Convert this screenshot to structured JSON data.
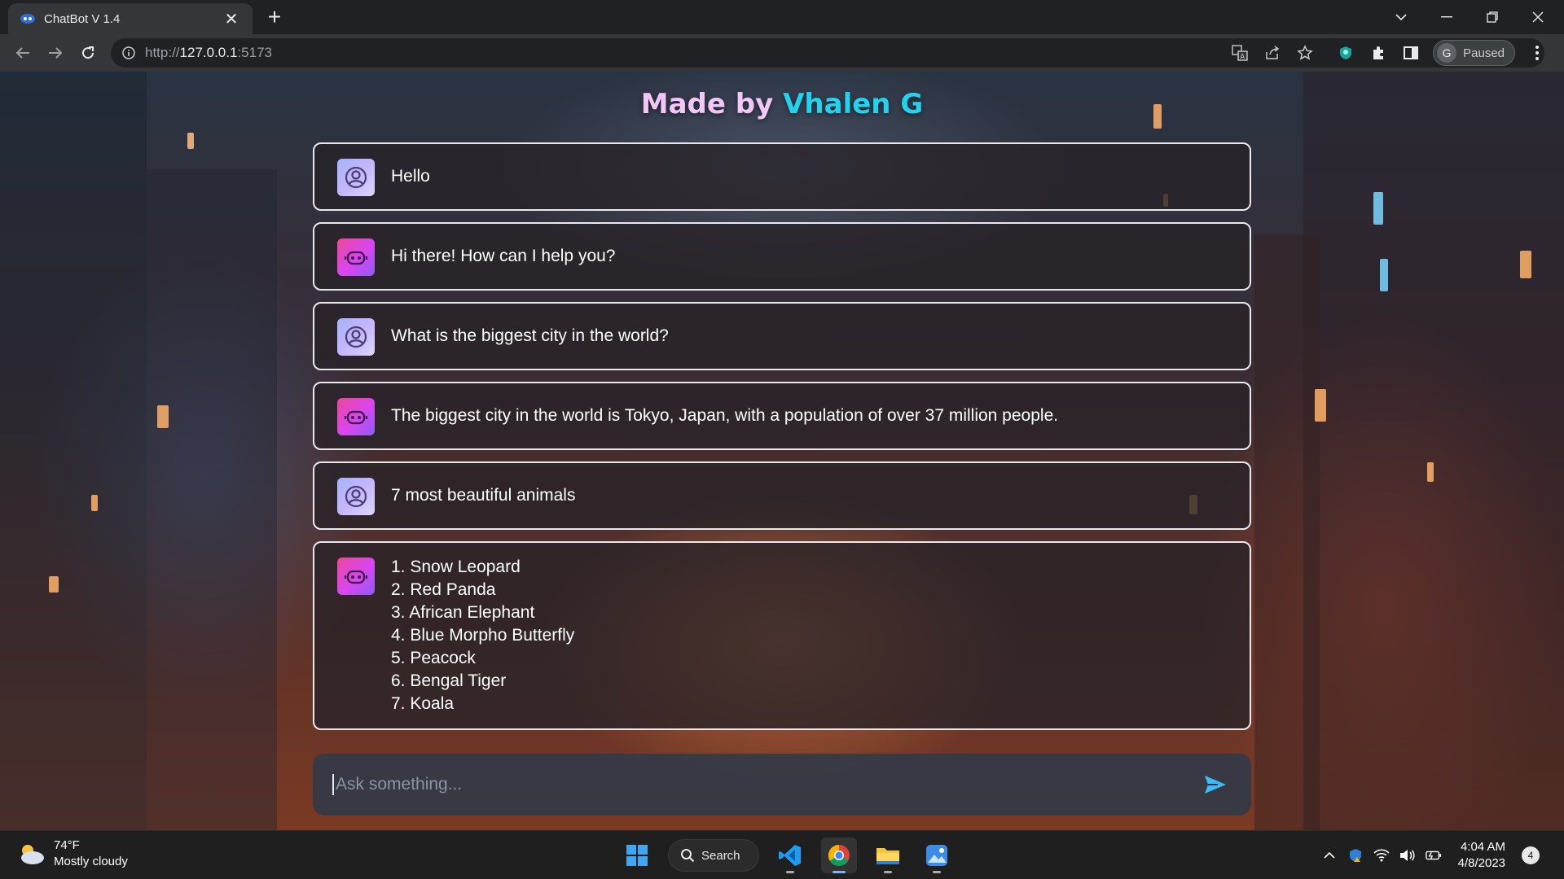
{
  "browser": {
    "tab_title": "ChatBot V 1.4",
    "tab_close": "✕",
    "new_tab": "+",
    "url_prefix": "http://",
    "url_host": "127.0.0.1",
    "url_suffix": ":5173",
    "profile_initial": "G",
    "profile_status": "Paused"
  },
  "page": {
    "heading_prefix": "Made by ",
    "heading_accent": "Vhalen G"
  },
  "messages": [
    {
      "role": "user",
      "text": "Hello"
    },
    {
      "role": "bot",
      "text": "Hi there! How can I help you?"
    },
    {
      "role": "user",
      "text": "What is the biggest city in the world?"
    },
    {
      "role": "bot",
      "text": "The biggest city in the world is Tokyo, Japan, with a population of over 37 million people."
    },
    {
      "role": "user",
      "text": "7 most beautiful animals"
    },
    {
      "role": "bot",
      "text": "1. Snow Leopard\n2. Red Panda\n3. African Elephant\n4. Blue Morpho Butterfly\n5. Peacock\n6. Bengal Tiger\n7. Koala"
    }
  ],
  "composer": {
    "placeholder": "Ask something..."
  },
  "taskbar": {
    "weather_temp": "74°F",
    "weather_desc": "Mostly cloudy",
    "search_label": "Search",
    "time": "4:04 AM",
    "date": "4/8/2023",
    "notifications": "4"
  },
  "colors": {
    "heading": "#f2c6f7",
    "heading_accent": "#22d3ee",
    "user_avatar": "#a5b4fc",
    "bot_avatar": "#ec4899",
    "send_icon": "#38bdf8"
  }
}
